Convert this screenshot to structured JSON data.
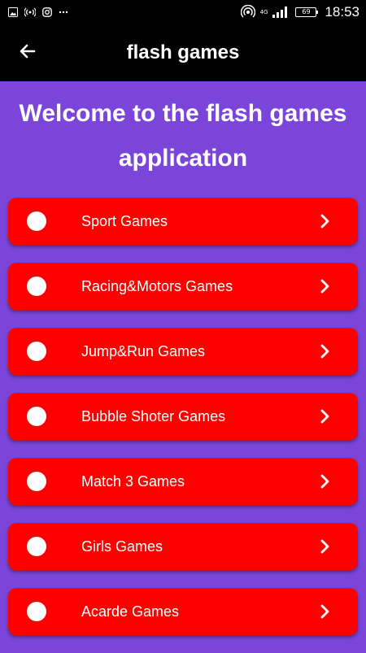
{
  "status_bar": {
    "time": "18:53",
    "network": "4G",
    "battery": "69",
    "icons": [
      "image-icon",
      "broadcast-icon",
      "instagram-icon",
      "more-icon",
      "hotspot-icon",
      "signal-icon",
      "battery-icon"
    ]
  },
  "app_bar": {
    "title": "flash games",
    "back_icon": "arrow-left-icon"
  },
  "welcome": {
    "text": "Welcome to the flash games application"
  },
  "menu": {
    "items": [
      {
        "label": "Sport Games"
      },
      {
        "label": "Racing&Motors Games"
      },
      {
        "label": "Jump&Run Games"
      },
      {
        "label": "Bubble Shoter Games"
      },
      {
        "label": "Match 3 Games"
      },
      {
        "label": "Girls Games"
      },
      {
        "label": "Acarde Games"
      }
    ]
  },
  "colors": {
    "background": "#7b45d9",
    "app_bar": "#000000",
    "item_background": "#ff0000",
    "text": "#ffffff"
  }
}
